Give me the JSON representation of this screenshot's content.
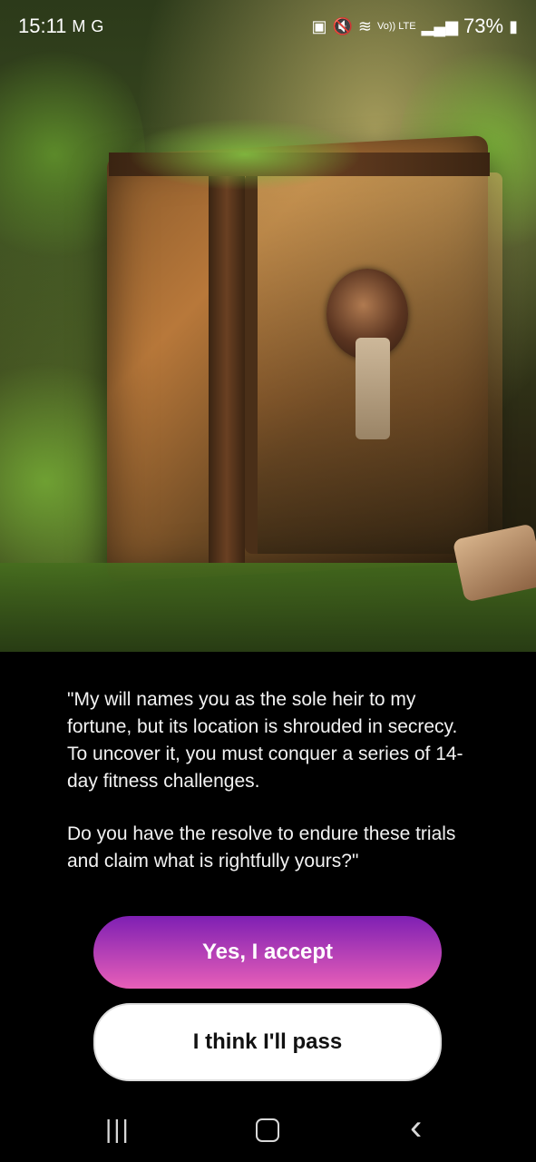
{
  "status_bar": {
    "time": "15:11",
    "left_icons": [
      "M",
      "G"
    ],
    "right_icons": [
      "battery-saver-icon",
      "mute-icon",
      "wifi-icon",
      "volte-icon",
      "signal-icon"
    ],
    "volte_label": "Vo)) LTE",
    "battery": "73%"
  },
  "hero": {
    "description_icon": "treasure-chest-illustration"
  },
  "story": {
    "paragraph1": "\"My will names you as the sole heir to my fortune, but its location is shrouded in secrecy. To uncover it, you must conquer a series of 14-day fitness challenges.",
    "paragraph2": "Do you have the resolve to endure these trials and claim what is rightfully yours?\""
  },
  "buttons": {
    "accept_label": "Yes, I accept",
    "pass_label": "I think I'll pass"
  },
  "nav": {
    "recent_glyph": "|||",
    "back_glyph": "‹"
  },
  "colors": {
    "accent_top": "#7e1fb3",
    "accent_bottom": "#e85fb8",
    "background": "#000000"
  }
}
